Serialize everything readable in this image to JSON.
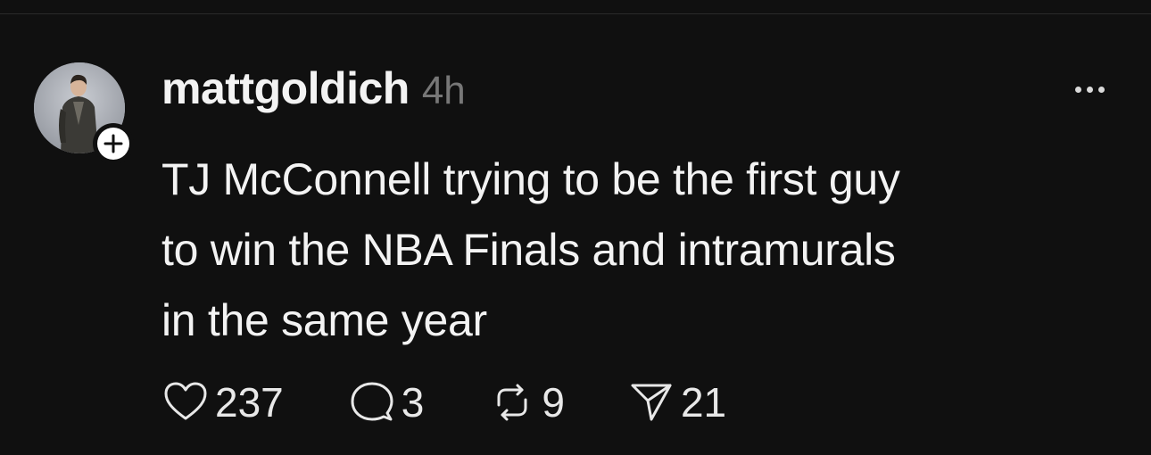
{
  "post": {
    "username": "mattgoldich",
    "timestamp": "4h",
    "text_lines": [
      "TJ McConnell trying to be the first guy",
      "to win the NBA Finals and intramurals",
      "in the same year"
    ],
    "follow_icon": "plus-icon",
    "more_icon": "ellipsis-icon"
  },
  "actions": {
    "likes": {
      "count": "237",
      "icon": "heart-icon"
    },
    "replies": {
      "count": "3",
      "icon": "comment-icon"
    },
    "reposts": {
      "count": "9",
      "icon": "repost-icon"
    },
    "shares": {
      "count": "21",
      "icon": "send-icon"
    }
  },
  "colors": {
    "background": "#101010",
    "text": "#f3f3f3",
    "muted": "#777777",
    "divider": "#2a2a2a"
  }
}
